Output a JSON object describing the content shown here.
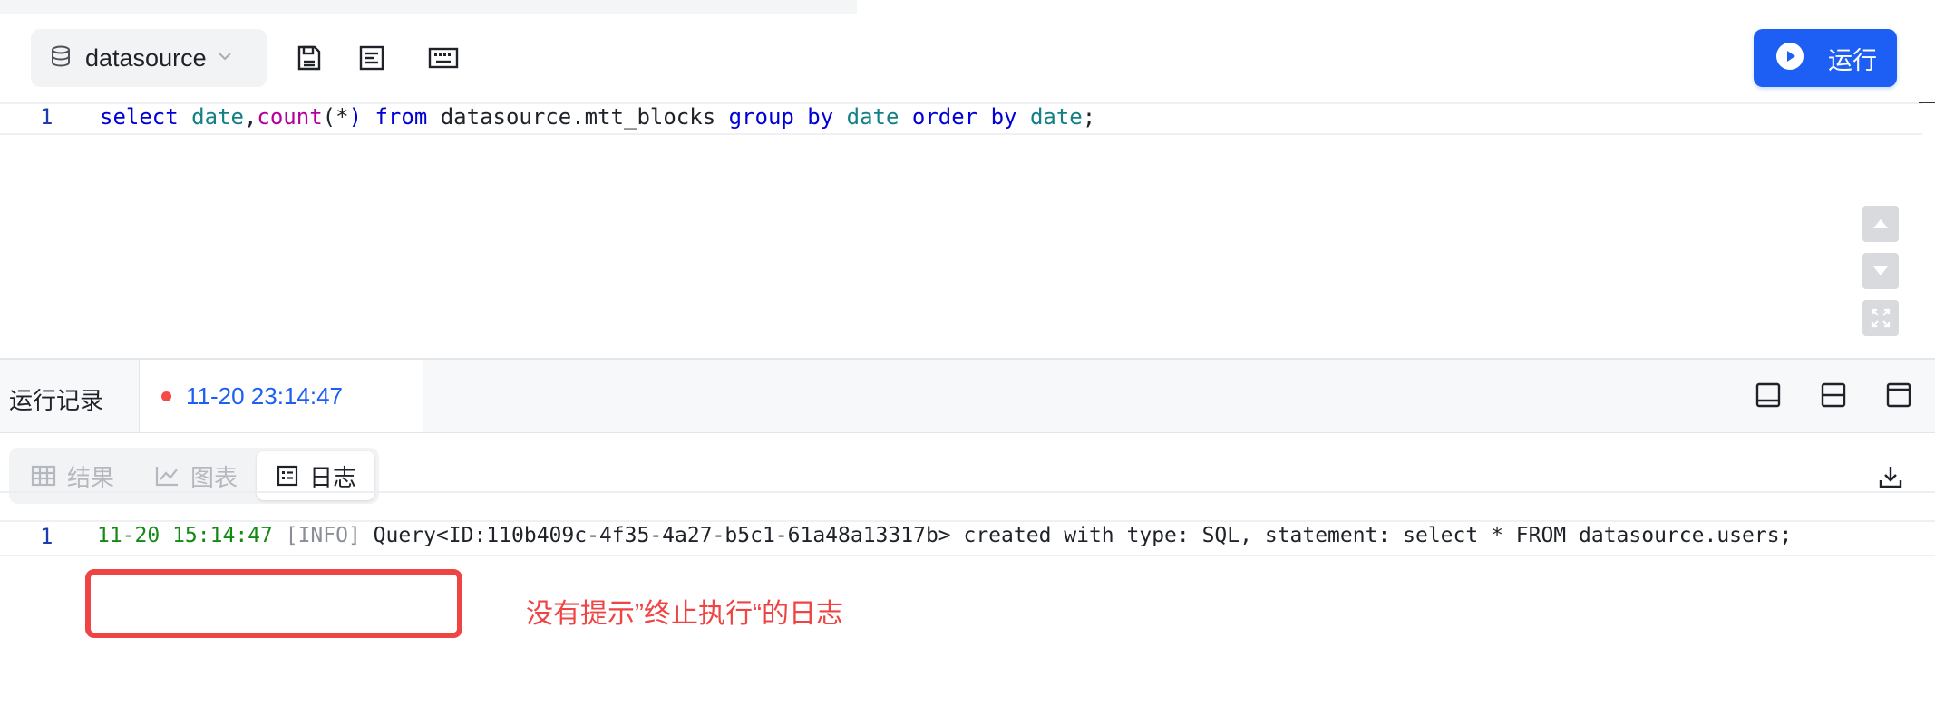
{
  "toolbar": {
    "datasource_label": "datasource",
    "run_label": "运行",
    "accent_color": "#1d5ef5"
  },
  "icons": {
    "datasource": "database-icon",
    "dropdown": "chevron-down-icon",
    "save": "save-icon",
    "format": "format-icon",
    "keyboard": "keyboard-icon",
    "run": "play-icon",
    "scroll_up": "arrow-up-icon",
    "scroll_down": "arrow-down-icon",
    "fullscreen": "fullscreen-icon",
    "layout_1": "panel-bottom-icon",
    "layout_2": "panel-split-icon",
    "layout_3": "panel-top-icon",
    "download": "download-icon"
  },
  "editor": {
    "line_number": "1",
    "tokens": [
      {
        "text": "select ",
        "kind": "kw"
      },
      {
        "text": "date",
        "kind": "id"
      },
      {
        "text": ",",
        "kind": "plain"
      },
      {
        "text": "count",
        "kind": "fn"
      },
      {
        "text": "(",
        "kind": "plain"
      },
      {
        "text": "*",
        "kind": "plain"
      },
      {
        "text": ") ",
        "kind": "kw"
      },
      {
        "text": "from ",
        "kind": "kw"
      },
      {
        "text": "datasource.mtt_blocks ",
        "kind": "plain"
      },
      {
        "text": "group by ",
        "kind": "kw"
      },
      {
        "text": "date ",
        "kind": "id"
      },
      {
        "text": "order by ",
        "kind": "kw"
      },
      {
        "text": "date",
        "kind": "id"
      },
      {
        "text": ";",
        "kind": "plain"
      }
    ]
  },
  "history": {
    "title": "运行记录",
    "tab_time": "11-20 23:14:47",
    "status_color": "#f54a45"
  },
  "result_tabs": [
    {
      "label": "结果",
      "icon": "table-icon"
    },
    {
      "label": "图表",
      "icon": "line-chart-icon"
    },
    {
      "label": "日志",
      "icon": "log-icon"
    }
  ],
  "log": {
    "line_number": "1",
    "timestamp": "11-20 15:14:47",
    "level": "[INFO]",
    "message": " Query<ID:110b409c-4f35-4a27-b5c1-61a48a13317b> created with type: SQL, statement: select * FROM datasource.users;"
  },
  "annotation": {
    "text": "没有提示”终止执行“的日志",
    "color": "#ef4444"
  }
}
